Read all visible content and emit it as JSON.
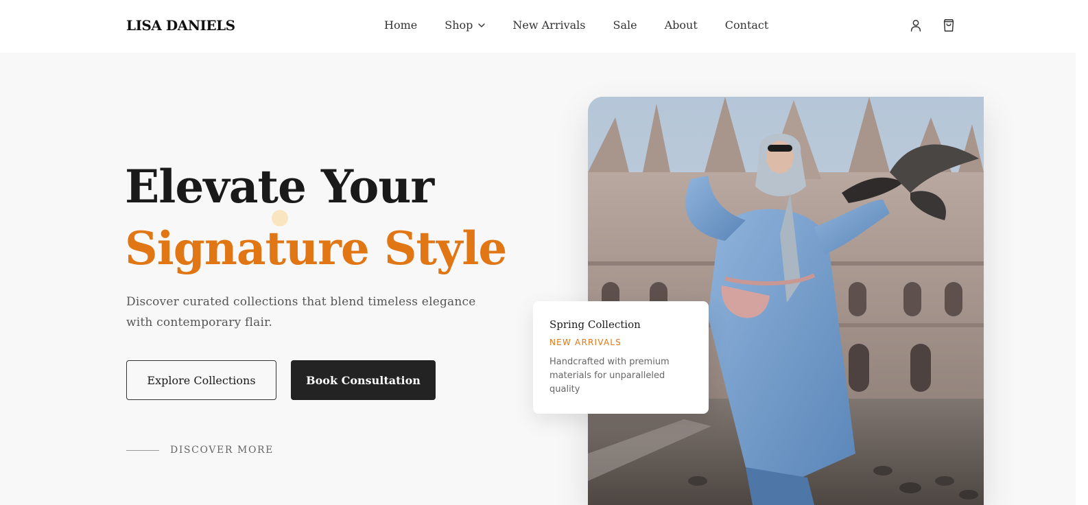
{
  "brand": {
    "name": "LISA DANIELS"
  },
  "nav": {
    "items": [
      {
        "label": "Home"
      },
      {
        "label": "Shop",
        "dropdown": true
      },
      {
        "label": "New Arrivals"
      },
      {
        "label": "Sale"
      },
      {
        "label": "About"
      },
      {
        "label": "Contact"
      }
    ]
  },
  "header_icons": [
    "user-icon",
    "shopping-bag-icon"
  ],
  "hero": {
    "title_line1": "Elevate Your",
    "title_line2": "Signature Style",
    "subtitle": "Discover curated collections that blend timeless elegance with contemporary flair.",
    "primary_button": "Explore Collections",
    "secondary_button": "Book Consultation",
    "discover_label": "DISCOVER MORE"
  },
  "card": {
    "title": "Spring Collection",
    "tag": "NEW ARRIVALS",
    "text": "Handcrafted with premium materials for unparalleled quality"
  },
  "colors": {
    "accent": "#e07614",
    "dark_button": "#232323",
    "background": "#f8f8f8"
  }
}
